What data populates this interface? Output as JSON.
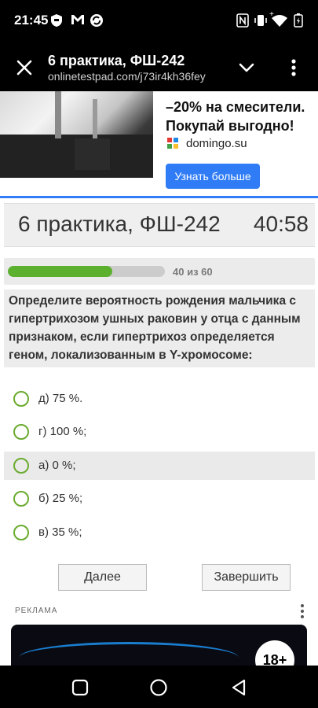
{
  "status_bar": {
    "time": "21:45",
    "left_icons": [
      "shield-icon",
      "gmail-icon",
      "sync-icon"
    ],
    "right_icons": [
      "nfc-icon",
      "vibrate-icon",
      "wifi-icon",
      "battery-icon"
    ],
    "wifi_badge": "+"
  },
  "browser": {
    "title": "6 практика, ФШ-242",
    "url": "onlinetestpad.com/j73ir4kh36fey"
  },
  "ad_top": {
    "headline_line1": "–20% на смесители.",
    "headline_line2": "Покупай выгодно!",
    "domain": "domingo.su",
    "cta": "Узнать больше",
    "accent_color": "#2f7cf6"
  },
  "test": {
    "title": "6 практика, ФШ-242",
    "timer": "40:58",
    "progress": {
      "label": "40 из 60",
      "fraction": 0.667,
      "color": "#5bb02e"
    },
    "question": "Определите вероятность рождения мальчика с гипертрихозом ушных раковин у отца с данным признаком, если гипертрихоз определяется геном, локализованным в Y-хромосоме:",
    "options": [
      {
        "label": "д) 75 %."
      },
      {
        "label": "г) 100 %;"
      },
      {
        "label": "а) 0 %;"
      },
      {
        "label": "б) 25 %;"
      },
      {
        "label": "в) 35 %;"
      }
    ],
    "buttons": {
      "next": "Далее",
      "finish": "Завершить"
    }
  },
  "ad_bottom": {
    "label": "РЕКЛАМА",
    "age_rating": "18+"
  }
}
